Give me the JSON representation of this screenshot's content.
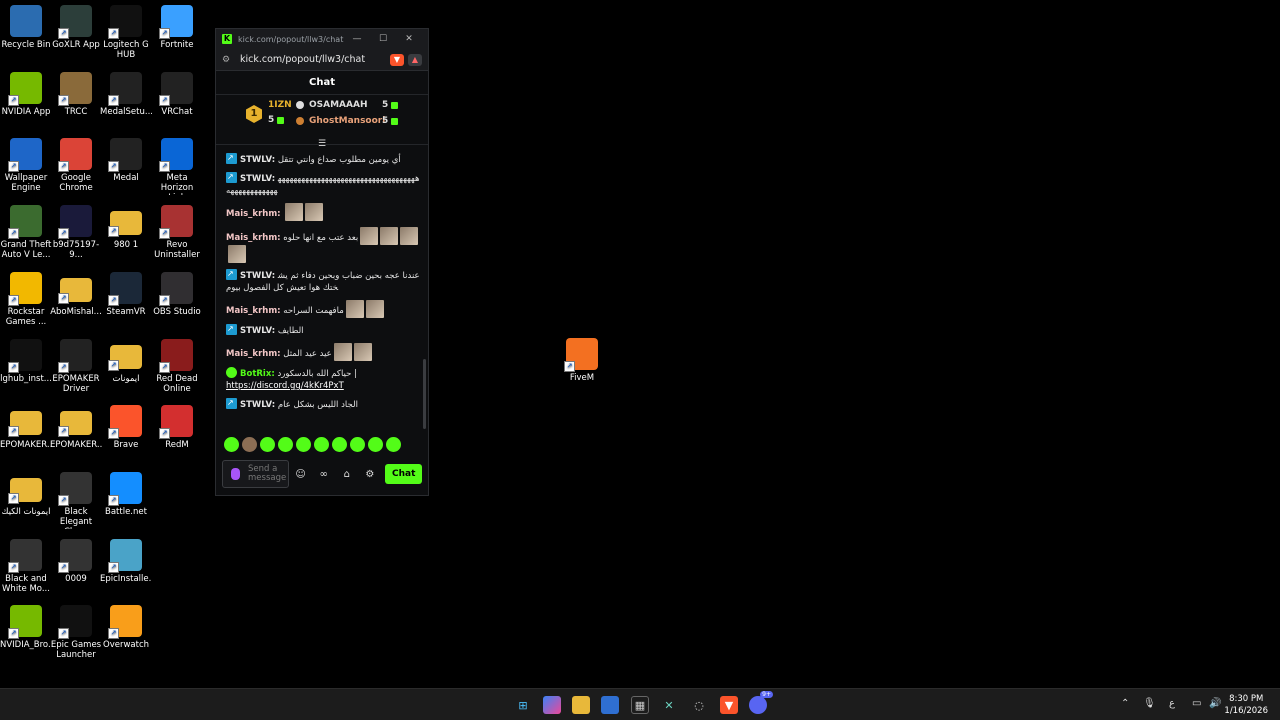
{
  "desktop_icons": [
    {
      "label": "Recycle Bin",
      "icon": "recycle-bin-icon",
      "color": "#2b6cb0"
    },
    {
      "label": "GoXLR App",
      "icon": "goxlr-icon",
      "color": "#2c3e3a"
    },
    {
      "label": "Logitech G HUB",
      "icon": "logitech-icon",
      "color": "#111111"
    },
    {
      "label": "Fortnite",
      "icon": "fortnite-icon",
      "color": "#3aa0ff"
    },
    {
      "label": "NVIDIA App",
      "icon": "nvidia-icon",
      "color": "#76b900"
    },
    {
      "label": "TRCC",
      "icon": "trcc-icon",
      "color": "#8a6a3a"
    },
    {
      "label": "MedalSetu...",
      "icon": "medal-icon",
      "color": "#222222"
    },
    {
      "label": "VRChat",
      "icon": "vrchat-icon",
      "color": "#222222"
    },
    {
      "label": "Wallpaper Engine",
      "icon": "wallpaper-engine-icon",
      "color": "#1e66c8"
    },
    {
      "label": "Google Chrome",
      "icon": "chrome-icon",
      "color": "#db4437"
    },
    {
      "label": "Medal",
      "icon": "medal-icon",
      "color": "#222222"
    },
    {
      "label": "Meta Horizon Link",
      "icon": "meta-icon",
      "color": "#0a66d6"
    },
    {
      "label": "Grand Theft Auto V Le...",
      "icon": "gta-icon",
      "color": "#3b6b2f"
    },
    {
      "label": "b9d75197-9...",
      "icon": "llw3-icon",
      "color": "#1a1a3a"
    },
    {
      "label": "980 1",
      "icon": "folder-icon",
      "color": "#e8b83a"
    },
    {
      "label": "Revo Uninstaller",
      "icon": "revo-icon",
      "color": "#a83232"
    },
    {
      "label": "Rockstar Games ...",
      "icon": "rockstar-icon",
      "color": "#f2b800"
    },
    {
      "label": "AboMishal...",
      "icon": "folder-icon",
      "color": "#e8b83a"
    },
    {
      "label": "SteamVR",
      "icon": "steamvr-icon",
      "color": "#1b2838"
    },
    {
      "label": "OBS Studio",
      "icon": "obs-icon",
      "color": "#302e31"
    },
    {
      "label": "lghub_inst...",
      "icon": "logitech-icon",
      "color": "#111111"
    },
    {
      "label": "EPOMAKER Driver",
      "icon": "epomaker-icon",
      "color": "#222222"
    },
    {
      "label": "ايمونات",
      "icon": "folder-icon",
      "color": "#e8b83a"
    },
    {
      "label": "Red Dead Online",
      "icon": "rdo-icon",
      "color": "#8a1c1c"
    },
    {
      "label": "EPOMAKER...",
      "icon": "folder-icon",
      "color": "#e8b83a"
    },
    {
      "label": "EPOMAKER...",
      "icon": "folder-icon",
      "color": "#e8b83a"
    },
    {
      "label": "Brave",
      "icon": "brave-icon",
      "color": "#fb542b"
    },
    {
      "label": "RedM",
      "icon": "redm-icon",
      "color": "#d32f2f"
    },
    {
      "label": "ايمونات الكيك",
      "icon": "folder-icon",
      "color": "#e8b83a"
    },
    {
      "label": "Black Elegant Clean Smo...",
      "icon": "video-icon",
      "color": "#333333"
    },
    {
      "label": "Battle.net",
      "icon": "battlenet-icon",
      "color": "#148eff"
    },
    {
      "label": "Black and White Mo...",
      "icon": "video-icon",
      "color": "#333333"
    },
    {
      "label": "0009",
      "icon": "video-icon",
      "color": "#333333"
    },
    {
      "label": "EpicInstalle...",
      "icon": "installer-icon",
      "color": "#4aa3c8"
    },
    {
      "label": "NVIDIA_Bro...",
      "icon": "nvidia-icon",
      "color": "#76b900"
    },
    {
      "label": "Epic Games Launcher",
      "icon": "epic-icon",
      "color": "#111111"
    },
    {
      "label": "Overwatch",
      "icon": "overwatch-icon",
      "color": "#f99e1a"
    },
    {
      "label": "FiveM",
      "icon": "fivem-icon",
      "color": "#f37021"
    }
  ],
  "browser": {
    "title": "kick.com/popout/llw3/chat...",
    "url": "kick.com/popout/llw3/chat",
    "min": "—",
    "max": "☐",
    "close": "✕"
  },
  "chat": {
    "header": "Chat",
    "leaderboard": {
      "rank": "1",
      "first_name": "1IZN",
      "first_count": "5",
      "second_name": "OSAMAAAH",
      "second_count": "5",
      "third_name": "GhostMansoori",
      "third_count": "5"
    },
    "messages": [
      {
        "user": "STWLV:",
        "color": "#e6e6e6",
        "badge": "sub",
        "text": "أي يومين مطلوب صداع وانتي تتقل"
      },
      {
        "user": "STWLV:",
        "color": "#e6e6e6",
        "badge": "sub",
        "text": "ههههههههههههههههههههههههههههههههههههههههههههههههه"
      },
      {
        "user": "Mais_krhm:",
        "color": "#f2c6c6",
        "badge": "",
        "text": ""
      },
      {
        "user": "Mais_krhm:",
        "color": "#f2c6c6",
        "badge": "",
        "text": "بعد عتب مع انها حلوه"
      },
      {
        "user": "STWLV:",
        "color": "#e6e6e6",
        "badge": "sub",
        "text": "عندنا عجه بحين ضباب وبحين دفاء ثم يشختك هوا تعيش كل الفصول بيوم"
      },
      {
        "user": "Mais_krhm:",
        "color": "#f2c6c6",
        "badge": "",
        "text": "مافهمت السراحه"
      },
      {
        "user": "STWLV:",
        "color": "#e6e6e6",
        "badge": "sub",
        "text": "الطايف"
      },
      {
        "user": "Mais_krhm:",
        "color": "#f2c6c6",
        "badge": "",
        "text": "عيد عيد المثل"
      },
      {
        "user": "BotRix:",
        "color": "#53fc18",
        "badge": "bot",
        "text": "حياكم الله بالدسكورد |",
        "link": "https://discord.gg/4kKr4PxT"
      },
      {
        "user": "STWLV:",
        "color": "#e6e6e6",
        "badge": "sub",
        "text": "الجاد الليس بشكل عام"
      }
    ],
    "input_placeholder": "Send a message",
    "send_label": "Chat",
    "colors": {
      "accent": "#53fc18",
      "background": "#0d0e10"
    }
  },
  "taskbar": {
    "apps": [
      "start-icon",
      "copilot-icon",
      "file-explorer-icon",
      "store-icon",
      "calculator-icon",
      "goxlr-icon",
      "obs-icon",
      "brave-icon",
      "discord-icon"
    ],
    "discord_badge": "9+",
    "lang": "ع",
    "time": "8:30 PM",
    "date": "1/16/2026"
  }
}
